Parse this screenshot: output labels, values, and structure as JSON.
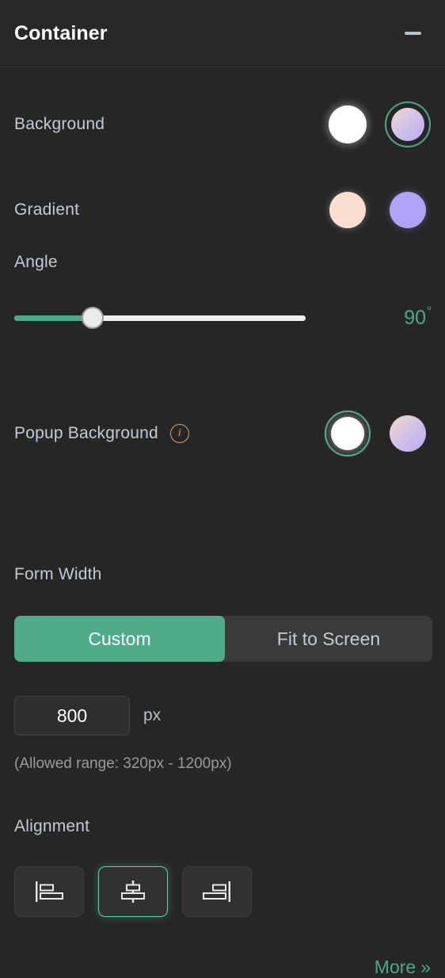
{
  "header": {
    "title": "Container",
    "collapse_icon": "minimize-icon"
  },
  "background": {
    "label": "Background",
    "swatches": [
      {
        "name": "white-swatch",
        "color": "#ffffff",
        "selected": false
      },
      {
        "name": "gradient-swatch",
        "color": "#d3c2e8",
        "selected": true
      }
    ]
  },
  "gradient": {
    "label": "Gradient",
    "swatches": [
      {
        "name": "peach-swatch",
        "color": "#fadfd0",
        "selected": false
      },
      {
        "name": "purple-swatch",
        "color": "#b0a3f5",
        "selected": false
      }
    ]
  },
  "angle": {
    "label": "Angle",
    "value": "90",
    "degree_symbol": "°",
    "percent": 27,
    "accent": "#4aab8a"
  },
  "popup_background": {
    "label": "Popup Background",
    "info_icon": "info-icon",
    "info_glyph": "i",
    "swatches": [
      {
        "name": "white-swatch",
        "color": "#ffffff",
        "selected": true
      },
      {
        "name": "gradient-swatch",
        "color": "#d3c2e8",
        "selected": false
      }
    ]
  },
  "form_width": {
    "label": "Form Width",
    "options": [
      {
        "label": "Custom",
        "selected": true
      },
      {
        "label": "Fit to Screen",
        "selected": false
      }
    ],
    "value": "800",
    "unit": "px",
    "hint": "(Allowed range: 320px - 1200px)"
  },
  "alignment": {
    "label": "Alignment",
    "options": [
      {
        "name": "align-left",
        "selected": false
      },
      {
        "name": "align-center",
        "selected": true
      },
      {
        "name": "align-right",
        "selected": false
      }
    ]
  },
  "footer": {
    "more_label": "More",
    "more_chevron": "»"
  },
  "colors": {
    "accent_green": "#4aab8a",
    "selected_green": "#4ddba4",
    "info_orange": "#e0a06a",
    "panel_bg": "#262626",
    "text": "#c4cbd6"
  }
}
